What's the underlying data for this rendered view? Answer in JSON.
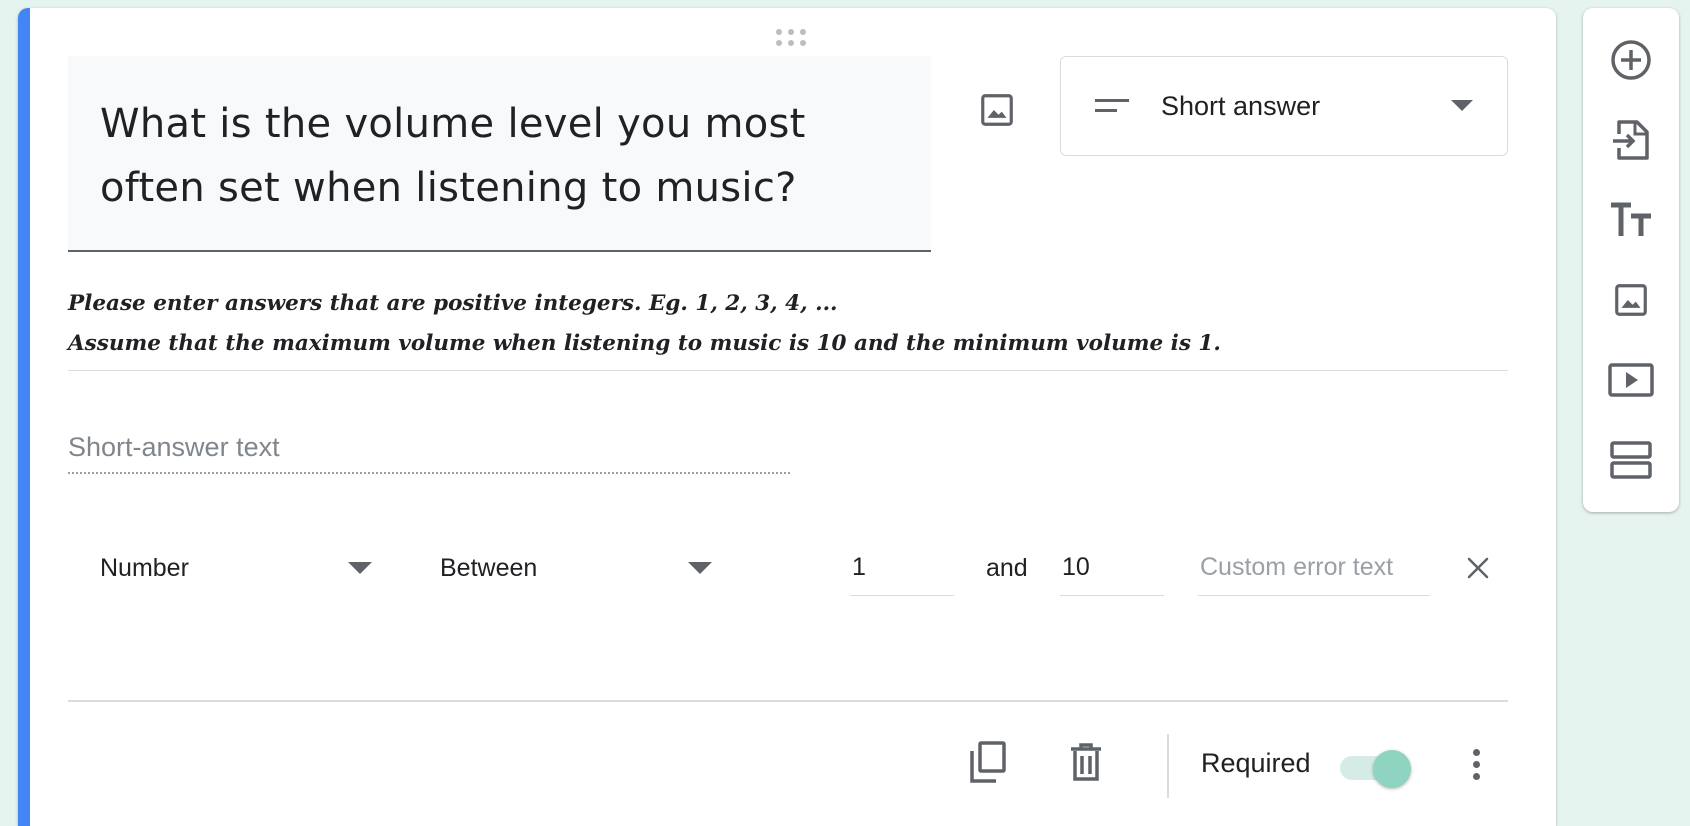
{
  "question": {
    "title": "What is the volume level you most often set when listening to music?",
    "description_lines": [
      "Please enter answers that are positive integers. Eg. 1, 2, 3, 4, ...",
      "Assume that the maximum volume when listening to music is 10 and the minimum volume is 1."
    ]
  },
  "type_select": {
    "label": "Short answer",
    "icon": "short-text-icon"
  },
  "answer": {
    "placeholder": "Short-answer text"
  },
  "validation": {
    "type": "Number",
    "condition": "Between",
    "min": "1",
    "joiner": "and",
    "max": "10",
    "error_placeholder": "Custom error text"
  },
  "footer": {
    "required_label": "Required",
    "required_on": true
  },
  "side_toolbar": {
    "icons": [
      "add-question-icon",
      "import-questions-icon",
      "add-title-icon",
      "add-image-icon",
      "add-video-icon",
      "add-section-icon"
    ]
  },
  "colors": {
    "accent": "#4285f4",
    "toggle_thumb": "#8fd3c1",
    "toggle_track": "#d4ece5",
    "background": "#e6f4ef"
  }
}
